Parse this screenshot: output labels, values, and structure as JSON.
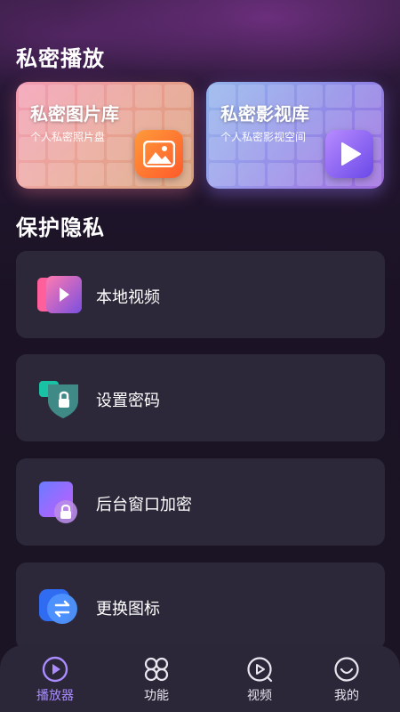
{
  "sections": {
    "private_play": "私密播放",
    "protect_privacy": "保护隐私"
  },
  "libraries": [
    {
      "title": "私密图片库",
      "subtitle": "个人私密照片盘",
      "icon": "image-icon"
    },
    {
      "title": "私密影视库",
      "subtitle": "个人私密影视空间",
      "icon": "play-icon"
    }
  ],
  "features": [
    {
      "label": "本地视频",
      "icon": "local-video-icon"
    },
    {
      "label": "设置密码",
      "icon": "shield-lock-icon"
    },
    {
      "label": "后台窗口加密",
      "icon": "window-lock-icon"
    },
    {
      "label": "更换图标",
      "icon": "swap-icon"
    }
  ],
  "tabs": [
    {
      "label": "播放器",
      "icon": "player-icon",
      "active": true
    },
    {
      "label": "功能",
      "icon": "grid-icon",
      "active": false
    },
    {
      "label": "视频",
      "icon": "video-icon",
      "active": false
    },
    {
      "label": "我的",
      "icon": "profile-icon",
      "active": false
    }
  ],
  "colors": {
    "background": "#1b1325",
    "card": "#2c2839",
    "accent": "#a98cff"
  }
}
